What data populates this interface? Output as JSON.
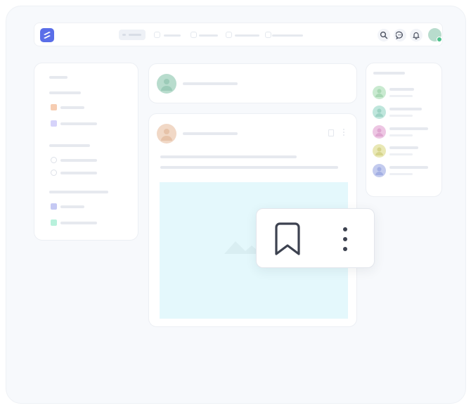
{
  "colors": {
    "brand": "#5a6ee8",
    "sidebar_dots": [
      "#f6cdb2",
      "#d6d3fa",
      "#c5c9f3",
      "#b8f1dc"
    ],
    "suggest_avatars": [
      "#c9ead0",
      "#bfe6dc",
      "#edc6e3",
      "#e9e8b5",
      "#c3cbee"
    ],
    "story_avatar": "#b8dccd",
    "post_avatar": "#f1d8c6",
    "post_image_bg": "#e4f8fc"
  },
  "icons": {
    "logo": "brand-logo-icon",
    "search": "search-icon",
    "messages": "chat-icon",
    "notifications": "bell-icon",
    "bookmark": "bookmark-icon",
    "more": "more-vertical-icon"
  }
}
